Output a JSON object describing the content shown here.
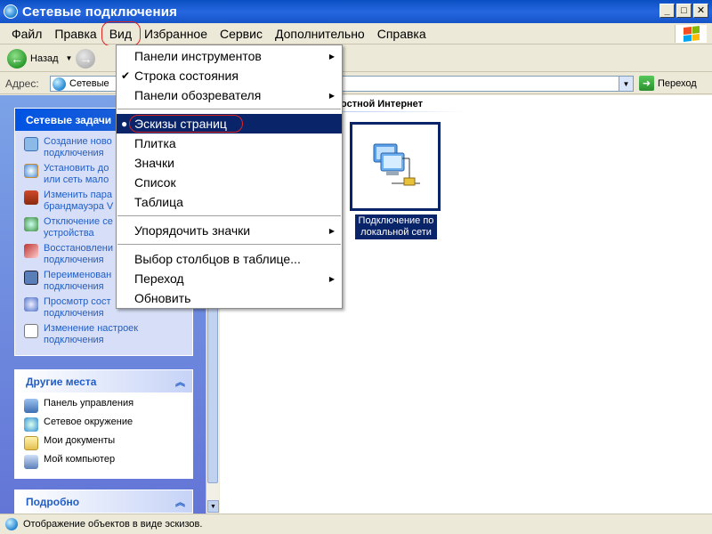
{
  "window": {
    "title": "Сетевые подключения"
  },
  "menubar": {
    "items": [
      "Файл",
      "Правка",
      "Вид",
      "Избранное",
      "Сервис",
      "Дополнительно",
      "Справка"
    ]
  },
  "toolbar": {
    "back_label": "Назад"
  },
  "address": {
    "label": "Адрес:",
    "value": "Сетевые",
    "go_label": "Переход"
  },
  "view_menu": {
    "items": [
      {
        "label": "Панели инструментов",
        "submenu": true
      },
      {
        "label": "Строка состояния",
        "checked": true
      },
      {
        "label": "Панели обозревателя",
        "submenu": true
      },
      {
        "label": "Эскизы страниц",
        "selected": true,
        "bullet": true
      },
      {
        "label": "Плитка"
      },
      {
        "label": "Значки"
      },
      {
        "label": "Список"
      },
      {
        "label": "Таблица"
      },
      {
        "label": "Упорядочить значки",
        "submenu": true
      },
      {
        "label": "Выбор столбцов в таблице..."
      },
      {
        "label": "Переход",
        "submenu": true
      },
      {
        "label": "Обновить"
      }
    ]
  },
  "task_pane": {
    "network_tasks": {
      "title": "Сетевые задачи",
      "items": [
        {
          "line1": "Создание ново",
          "line2": "подключения"
        },
        {
          "line1": "Установить до",
          "line2": "или сеть мало"
        },
        {
          "line1": "Изменить пара",
          "line2": "брандмауэра V"
        },
        {
          "line1": "Отключение се",
          "line2": "устройства"
        },
        {
          "line1": "Восстановлени",
          "line2": "подключения"
        },
        {
          "line1": "Переименован",
          "line2": "подключения"
        },
        {
          "line1": "Просмотр сост",
          "line2": "подключения"
        },
        {
          "line1": "Изменение настроек",
          "line2": "подключения"
        }
      ]
    },
    "other_places": {
      "title": "Другие места",
      "items": [
        "Панель управления",
        "Сетевое окружение",
        "Мои документы",
        "Мой компьютер"
      ]
    },
    "details": {
      "title": "Подробно"
    }
  },
  "content": {
    "group_header": "остной Интернет",
    "item_caption_line1": "Подключение по",
    "item_caption_line2": "локальной сети"
  },
  "statusbar": {
    "text": "Отображение объектов в виде эскизов."
  }
}
